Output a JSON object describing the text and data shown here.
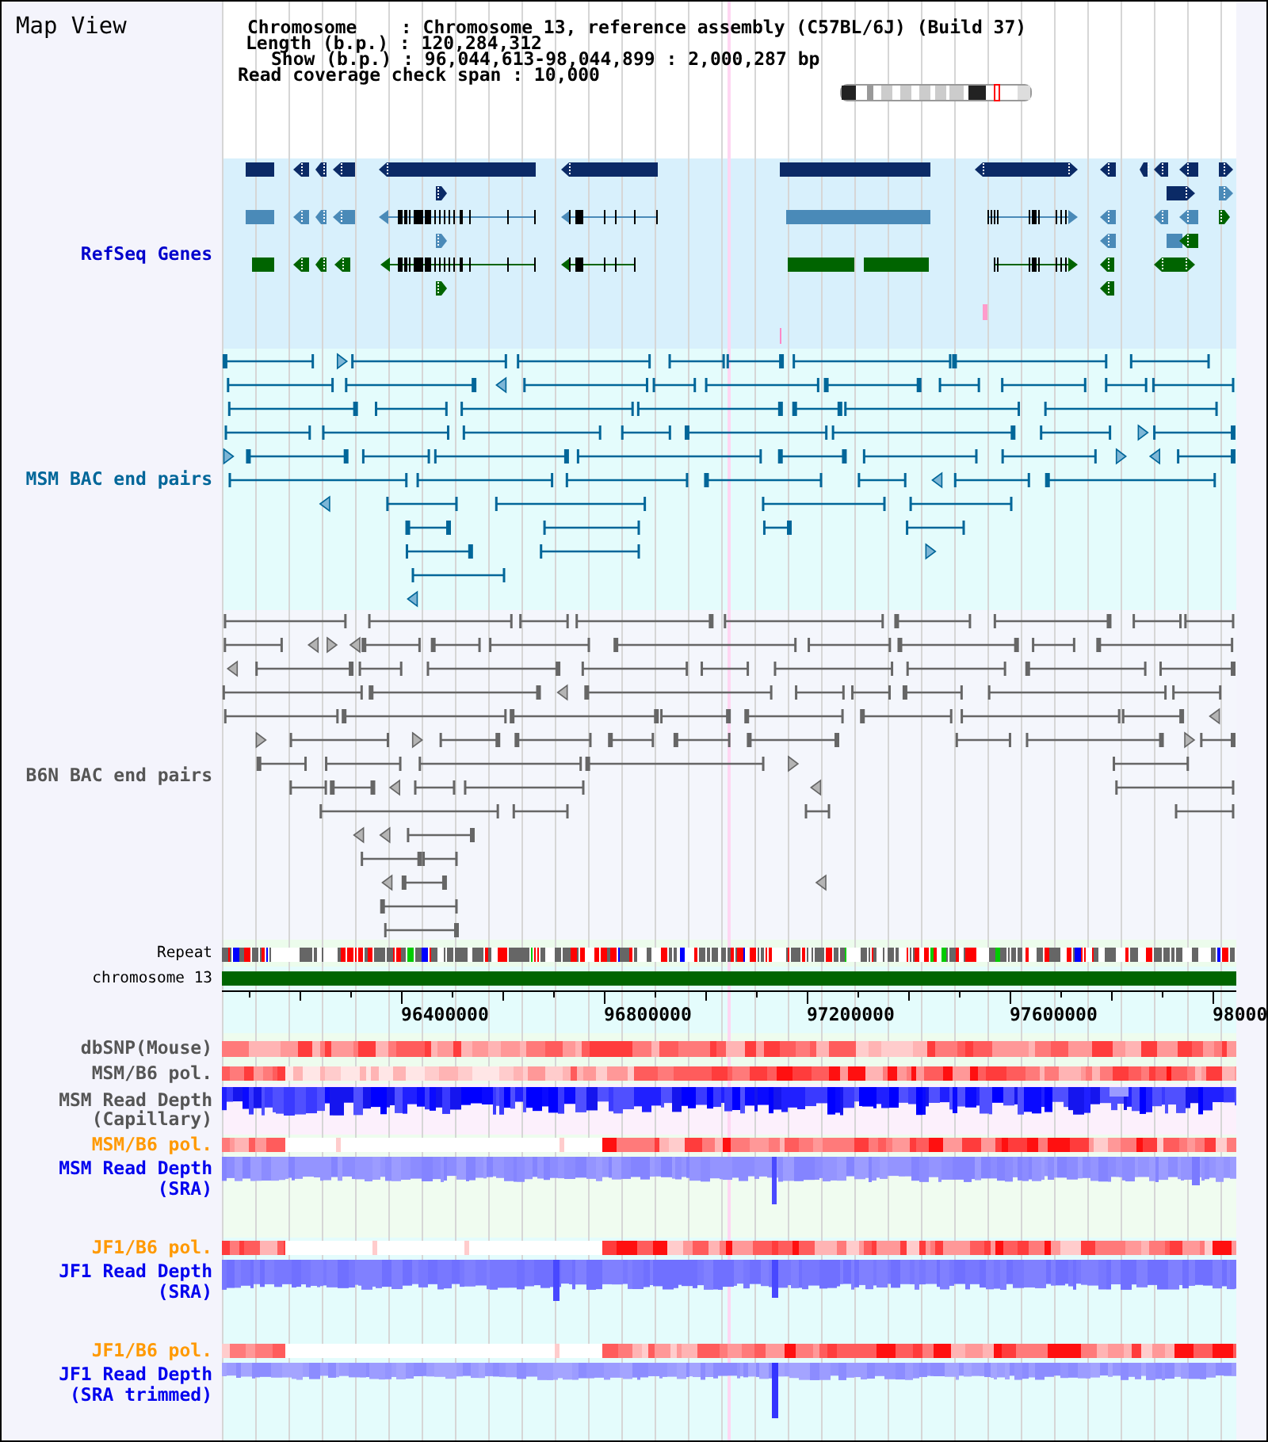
{
  "title": "Map View",
  "info_lines": [
    "Chromosome    : Chromosome 13, reference assembly (C57BL/6J) (Build 37)",
    "Length (b.p.) : 120,284,312",
    "Show (b.p.) : 96,044,613-98,044,899 : 2,000,287 bp",
    "Read coverage check span : 10,000"
  ],
  "upper_tracks": [
    {
      "label": "RefSeq Genes",
      "kind": "genes",
      "color": "#0000cc"
    },
    {
      "label": "MSM BAC end pairs",
      "kind": "bac_pairs",
      "color": "#006699"
    },
    {
      "label": "B6N BAC end pairs",
      "kind": "bac_pairs",
      "color": "#555555"
    },
    {
      "label": "Repeat",
      "kind": "repeat",
      "color": "#000000"
    },
    {
      "label": "chromosome 13",
      "kind": "chromosome",
      "color": "#000000"
    }
  ],
  "axis": {
    "tick_labels": [
      "96400000",
      "96800000",
      "97200000",
      "97600000",
      "98000"
    ]
  },
  "lower_tracks": [
    {
      "label": [
        "dbSNP(Mouse)"
      ],
      "kind": "heatmap",
      "color": "#555555"
    },
    {
      "label": [
        "MSM/B6 pol."
      ],
      "kind": "heatmap",
      "color": "#555555"
    },
    {
      "label": [
        "MSM Read Depth",
        "(Capillary)"
      ],
      "kind": "depth",
      "color": "#555555"
    },
    {
      "label": [
        "MSM/B6 pol."
      ],
      "kind": "heatmap",
      "color": "#ff9900"
    },
    {
      "label": [
        "MSM Read Depth",
        "(SRA)"
      ],
      "kind": "depth",
      "color": "#0000ee"
    },
    {
      "label": [
        "JF1/B6 pol."
      ],
      "kind": "heatmap",
      "color": "#ff9900"
    },
    {
      "label": [
        "JF1 Read Depth",
        "(SRA)"
      ],
      "kind": "depth",
      "color": "#0000ee"
    },
    {
      "label": [
        "JF1/B6 pol."
      ],
      "kind": "heatmap",
      "color": "#ff9900"
    },
    {
      "label": [
        "JF1 Read Depth",
        "(SRA trimmed)"
      ],
      "kind": "depth",
      "color": "#0000ee"
    }
  ]
}
